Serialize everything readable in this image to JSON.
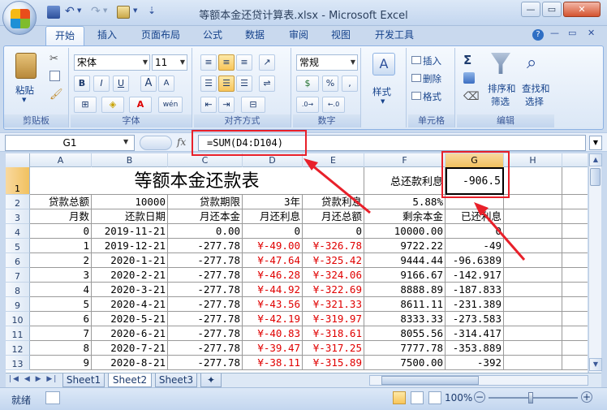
{
  "window": {
    "title": "等额本金还贷计算表.xlsx - Microsoft Excel"
  },
  "ribbon_tabs": [
    "开始",
    "插入",
    "页面布局",
    "公式",
    "数据",
    "审阅",
    "视图",
    "开发工具"
  ],
  "ribbon": {
    "clipboard": {
      "paste": "粘贴",
      "label": "剪贴板"
    },
    "font": {
      "name": "宋体",
      "size": "11",
      "bold": "B",
      "italic": "I",
      "underline": "U",
      "grow": "A",
      "shrink": "A",
      "phonetic": "wén",
      "label": "字体"
    },
    "alignment": {
      "label": "对齐方式"
    },
    "number": {
      "format": "常规",
      "percent": "%",
      "comma": ",",
      "label": "数字"
    },
    "styles": {
      "style": "样式"
    },
    "cells": {
      "insert": "插入",
      "delete": "删除",
      "format": "格式",
      "label": "单元格"
    },
    "editing": {
      "sum": "Σ",
      "sort": "排序和",
      "sort2": "筛选",
      "find": "查找和",
      "find2": "选择",
      "label": "编辑"
    }
  },
  "formula_bar": {
    "name_box": "G1",
    "fx": "fx",
    "formula": "=SUM(D4:D104)"
  },
  "columns": [
    "A",
    "B",
    "C",
    "D",
    "E",
    "F",
    "G",
    "H"
  ],
  "rows": [
    "1",
    "2",
    "3",
    "4",
    "5",
    "6",
    "7",
    "8",
    "9",
    "10",
    "11",
    "12",
    "13"
  ],
  "sheet": {
    "title": "等额本金还款表",
    "total_interest_label": "总还款利息",
    "total_interest_value": "-906.5",
    "row2": {
      "a": "贷款总额",
      "b": "10000",
      "c": "贷款期限",
      "d": "3年",
      "e": "贷款利息",
      "f": "5.88%"
    },
    "headers": {
      "a": "月数",
      "b": "还款日期",
      "c": "月还本金",
      "d": "月还利息",
      "e": "月还总额",
      "f": "剩余本金",
      "g": "已还利息"
    },
    "data": [
      {
        "a": "0",
        "b": "2019-11-21",
        "c": "0.00",
        "d": "0",
        "e": "0",
        "f": "10000.00",
        "g": "0"
      },
      {
        "a": "1",
        "b": "2019-12-21",
        "c": "-277.78",
        "d": "¥-49.00",
        "e": "¥-326.78",
        "f": "9722.22",
        "g": "-49"
      },
      {
        "a": "2",
        "b": "2020-1-21",
        "c": "-277.78",
        "d": "¥-47.64",
        "e": "¥-325.42",
        "f": "9444.44",
        "g": "-96.6389"
      },
      {
        "a": "3",
        "b": "2020-2-21",
        "c": "-277.78",
        "d": "¥-46.28",
        "e": "¥-324.06",
        "f": "9166.67",
        "g": "-142.917"
      },
      {
        "a": "4",
        "b": "2020-3-21",
        "c": "-277.78",
        "d": "¥-44.92",
        "e": "¥-322.69",
        "f": "8888.89",
        "g": "-187.833"
      },
      {
        "a": "5",
        "b": "2020-4-21",
        "c": "-277.78",
        "d": "¥-43.56",
        "e": "¥-321.33",
        "f": "8611.11",
        "g": "-231.389"
      },
      {
        "a": "6",
        "b": "2020-5-21",
        "c": "-277.78",
        "d": "¥-42.19",
        "e": "¥-319.97",
        "f": "8333.33",
        "g": "-273.583"
      },
      {
        "a": "7",
        "b": "2020-6-21",
        "c": "-277.78",
        "d": "¥-40.83",
        "e": "¥-318.61",
        "f": "8055.56",
        "g": "-314.417"
      },
      {
        "a": "8",
        "b": "2020-7-21",
        "c": "-277.78",
        "d": "¥-39.47",
        "e": "¥-317.25",
        "f": "7777.78",
        "g": "-353.889"
      },
      {
        "a": "9",
        "b": "2020-8-21",
        "c": "-277.78",
        "d": "¥-38.11",
        "e": "¥-315.89",
        "f": "7500.00",
        "g": "-392"
      }
    ]
  },
  "sheet_tabs": [
    "Sheet1",
    "Sheet2",
    "Sheet3"
  ],
  "status": {
    "ready": "就绪",
    "zoom": "100%"
  },
  "colors": {
    "accent": "#15428b",
    "negative": "#e00000",
    "highlight": "#e8202a"
  }
}
